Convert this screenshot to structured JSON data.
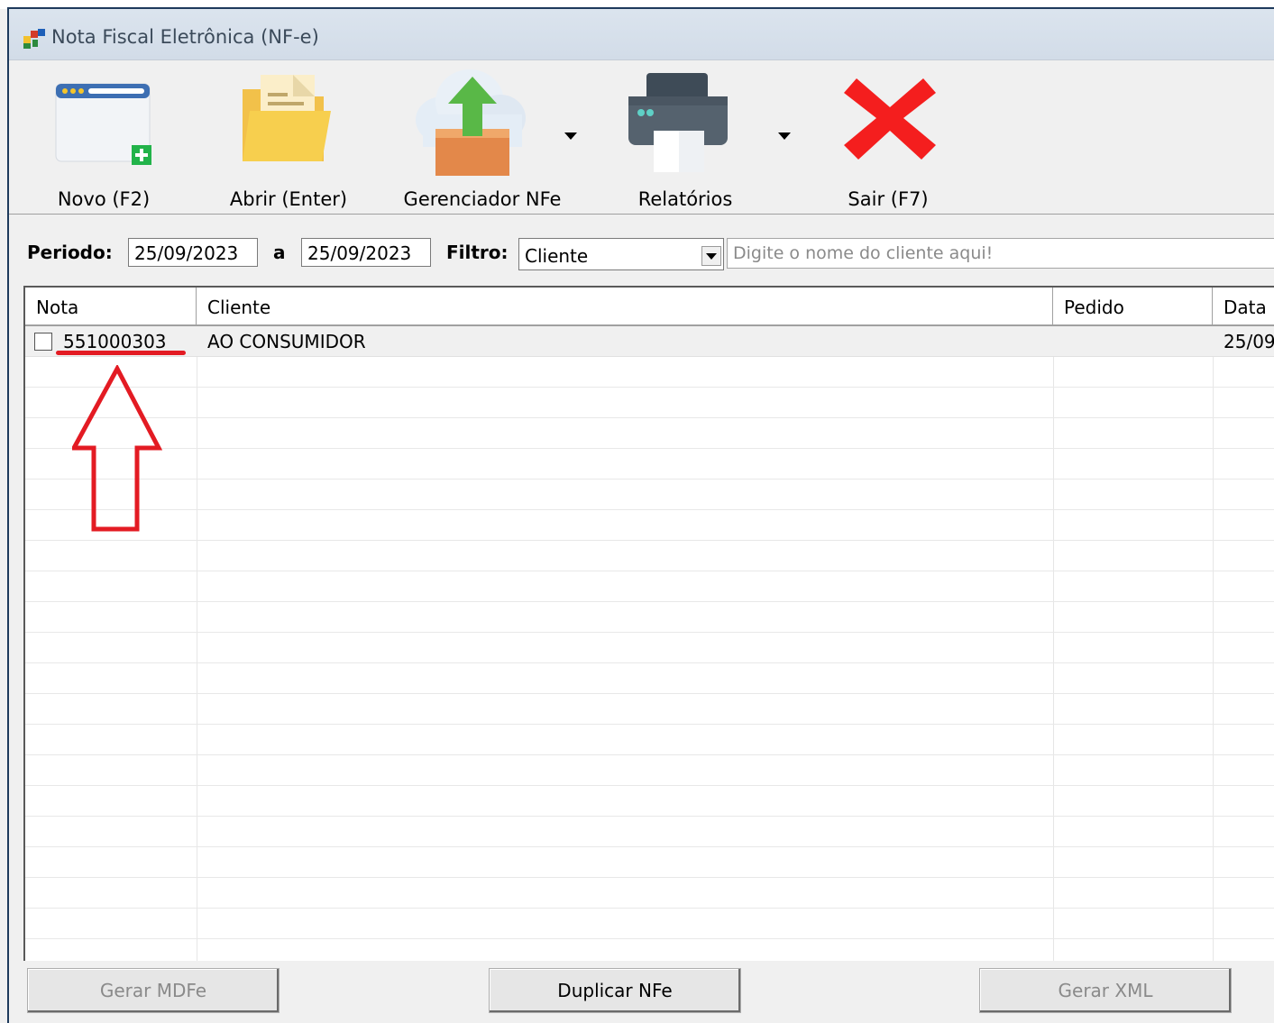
{
  "window": {
    "title": "Nota Fiscal Eletrônica (NF-e)"
  },
  "toolbar": {
    "buttons": [
      {
        "label": "Novo (F2)",
        "icon": "new-window-icon"
      },
      {
        "label": "Abrir (Enter)",
        "icon": "folder-icon"
      },
      {
        "label": "Gerenciador NFe",
        "icon": "cloud-upload-icon",
        "dropdown": true
      },
      {
        "label": "Relatórios",
        "icon": "printer-icon",
        "dropdown": true
      },
      {
        "label": "Sair (F7)",
        "icon": "red-x-icon"
      }
    ]
  },
  "filters": {
    "periodo_label": "Periodo:",
    "date_from": "25/09/2023",
    "a_label": "a",
    "date_to": "25/09/2023",
    "filtro_label": "Filtro:",
    "filtro_selected": "Cliente",
    "search_placeholder": "Digite o nome do cliente aqui!"
  },
  "grid": {
    "columns": [
      "Nota",
      "Cliente",
      "Pedido",
      "Data"
    ],
    "rows": [
      {
        "nota": "551000303",
        "cliente": "AO CONSUMIDOR",
        "pedido": "",
        "data": "25/09",
        "checked": false,
        "selected": true
      }
    ]
  },
  "annotation": {
    "color": "#e31b23"
  },
  "footer": {
    "gerar_mdfe": "Gerar MDFe",
    "duplicar_nfe": "Duplicar NFe",
    "gerar_xml": "Gerar XML"
  }
}
